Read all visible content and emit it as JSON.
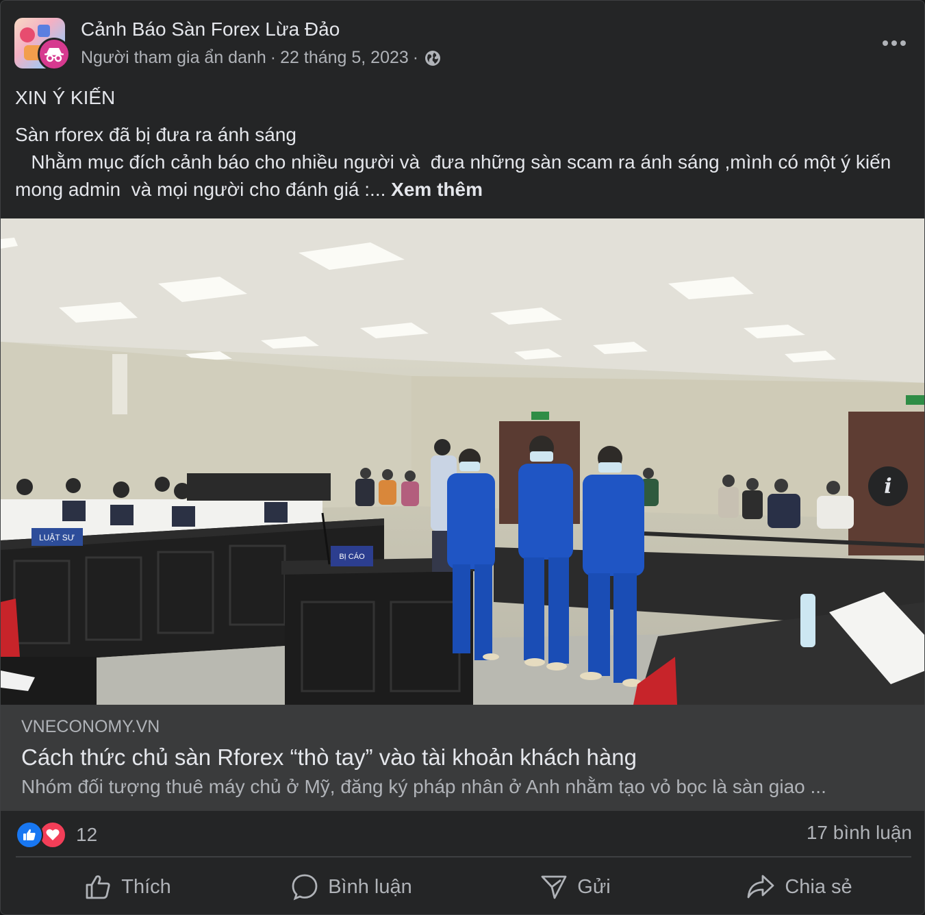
{
  "post": {
    "group_name": "Cảnh Báo Sàn Forex Lừa Đảo",
    "author": "Người tham gia ẩn danh",
    "separator": "·",
    "date": "22 tháng 5, 2023",
    "audience_icon": "globe-icon",
    "title": "XIN Ý KIẾN",
    "body_line1": "Sàn rforex đã bị đưa ra ánh sáng",
    "body_line2": "   Nhằm mục đích cảnh báo cho nhiều người và  đưa những sàn scam ra ánh sáng ,mình có một ý kiến mong admin  và mọi người cho đánh giá :... ",
    "see_more": "Xem thêm"
  },
  "link_preview": {
    "domain": "VNECONOMY.VN",
    "title": "Cách thức chủ sàn Rforex “thò tay” vào tài khoản khách hàng",
    "description": "Nhóm đối tượng thuê máy chủ ở Mỹ, đăng ký pháp nhân ở Anh nhằm tạo vỏ bọc là sàn giao ...",
    "photo_signs": {
      "lawyer": "LUẬT SƯ",
      "defendant": "BỊ CÁO"
    }
  },
  "reactions": {
    "count": "12",
    "types": [
      "like",
      "love"
    ],
    "comments": "17 bình luận"
  },
  "actions": [
    {
      "label": "Thích",
      "icon": "thumbs-up-icon"
    },
    {
      "label": "Bình luận",
      "icon": "comment-icon"
    },
    {
      "label": "Gửi",
      "icon": "send-icon"
    },
    {
      "label": "Chia sẻ",
      "icon": "share-icon"
    }
  ],
  "colors": {
    "background": "#242526",
    "link_box": "#3a3b3c",
    "text": "#e4e6eb",
    "secondary": "#b0b3b8",
    "like": "#1877f2",
    "love": "#f33e58",
    "uniform": "#1f55c4"
  }
}
